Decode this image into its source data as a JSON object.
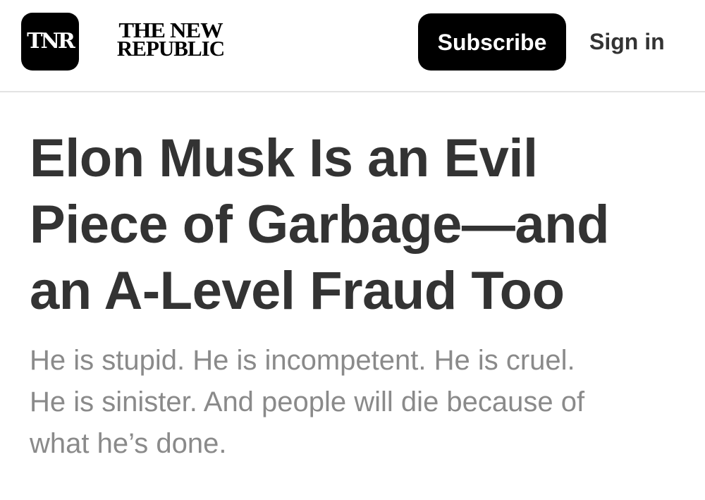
{
  "header": {
    "logo_mark": "TNR",
    "wordmark_line1": "THE NEW",
    "wordmark_line2": "REPUBLIC",
    "subscribe_label": "Subscribe",
    "signin_label": "Sign in"
  },
  "article": {
    "headline_line1": "Elon Musk Is an Evil",
    "headline_line2": "Piece of Garbage—and",
    "headline_line3": "an A-Level Fraud Too",
    "dek_line1": "He is stupid. He is incompetent. He is cruel.",
    "dek_line2": "He is sinister. And people will die because of",
    "dek_line3": "what he’s done."
  },
  "colors": {
    "brand_black": "#000000",
    "headline_text": "#333333",
    "dek_text": "#8a8a8a",
    "divider": "#e3e3e3"
  }
}
